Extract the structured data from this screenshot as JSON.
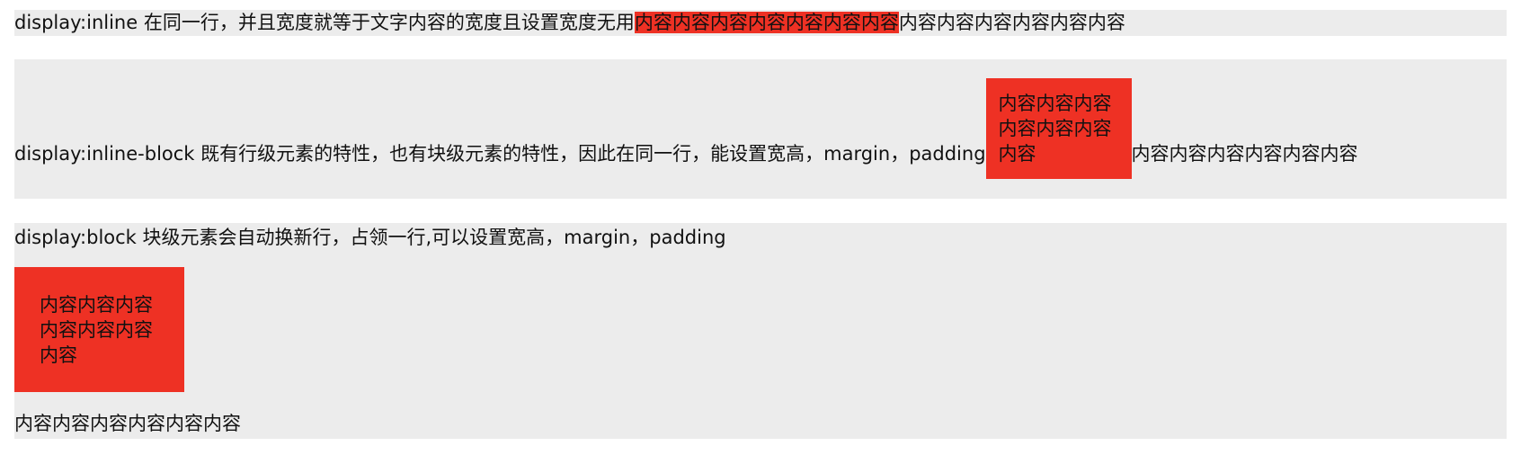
{
  "inline_section": {
    "description": "display:inline 在同一行，并且宽度就等于文字内容的宽度且设置宽度无用",
    "element_text": "内容内容内容内容内容内容内容",
    "trailing_text": "内容内容内容内容内容内容"
  },
  "inline_block_section": {
    "description": "display:inline-block 既有行级元素的特性，也有块级元素的特性，因此在同一行，能设置宽高，margin，padding",
    "element_text": "内容内容内容内容内容内容内容",
    "trailing_text": "内容内容内容内容内容内容"
  },
  "block_section": {
    "description": "display:block 块级元素会自动换新行，占领一行,可以设置宽高，margin，padding",
    "element_text": "内容内容内容内容内容内容内容",
    "trailing_text": "内容内容内容内容内容内容"
  },
  "colors": {
    "section_background": "#ececec",
    "element_red": "#ee3124",
    "text": "#111111"
  }
}
